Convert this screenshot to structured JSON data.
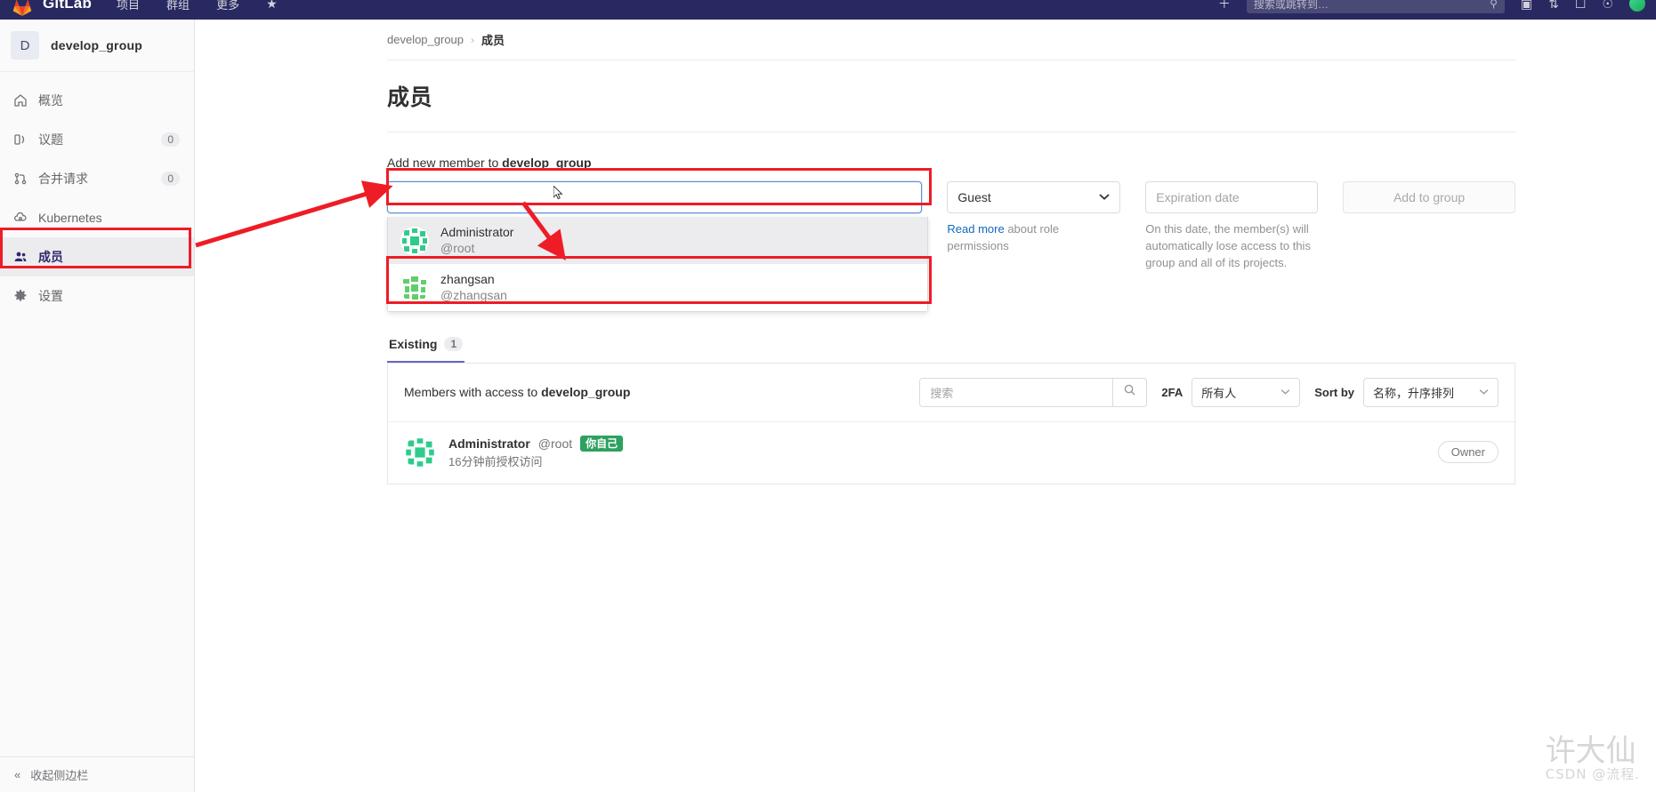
{
  "topbar": {
    "brand": "GitLab",
    "nav_items": [
      "项目",
      "群组",
      "更多"
    ],
    "search_placeholder": "搜索或跳转到…",
    "icons": [
      "plus-icon",
      "issues-icon",
      "merge-requests-icon",
      "todos-icon",
      "help-icon",
      "user-avatar"
    ]
  },
  "sidebar": {
    "context": {
      "avatar_letter": "D",
      "name": "develop_group"
    },
    "items": [
      {
        "label": "概览",
        "icon": "home-icon",
        "count": "",
        "active": false
      },
      {
        "label": "议题",
        "icon": "issues-icon",
        "count": "0",
        "active": false
      },
      {
        "label": "合并请求",
        "icon": "merge-request-icon",
        "count": "0",
        "active": false
      },
      {
        "label": "Kubernetes",
        "icon": "kubernetes-icon",
        "count": "",
        "active": false
      },
      {
        "label": "成员",
        "icon": "users-icon",
        "count": "",
        "active": true
      },
      {
        "label": "设置",
        "icon": "gear-icon",
        "count": "",
        "active": false
      }
    ],
    "collapse_label": "收起侧边栏"
  },
  "breadcrumb": {
    "group": "develop_group",
    "separator": "›",
    "current": "成员"
  },
  "page": {
    "title": "成员"
  },
  "invite": {
    "label_prefix": "Add new member to ",
    "label_group": "develop_group",
    "user_input_value": "",
    "role": {
      "selected": "Guest",
      "chevron": "⌄"
    },
    "role_help_link": "Read more",
    "role_help_rest": " about role permissions",
    "expiration": {
      "placeholder": "Expiration date",
      "value": ""
    },
    "expiration_help": "On this date, the member(s) will automatically lose access to this group and all of its projects.",
    "submit_label": "Add to group"
  },
  "dropdown": {
    "items": [
      {
        "name": "Administrator",
        "handle": "@root",
        "highlighted": true
      },
      {
        "name": "zhangsan",
        "handle": "@zhangsan",
        "highlighted": false
      }
    ]
  },
  "tabs": [
    {
      "label": "Existing",
      "count": "1",
      "active": true
    }
  ],
  "filters": {
    "title_prefix": "Members with access to ",
    "title_group": "develop_group",
    "search_placeholder": "搜索",
    "search_icon": "search-icon",
    "twofa_label": "2FA",
    "twofa_value": "所有人",
    "sort_label": "Sort by",
    "sort_value": "名称，升序排列"
  },
  "members": [
    {
      "name": "Administrator",
      "handle": "@root",
      "badge": "你自己",
      "sub": "16分钟前授权访问",
      "role": "Owner"
    }
  ],
  "watermark": {
    "main": "许大仙",
    "sub": "CSDN @流程."
  },
  "colors": {
    "topbar_bg": "#292961",
    "accent": "#6666c4",
    "link": "#1068bf",
    "badge_green": "#2da160",
    "annotation_red": "#ee1c25",
    "active_nav": "#ececef"
  }
}
